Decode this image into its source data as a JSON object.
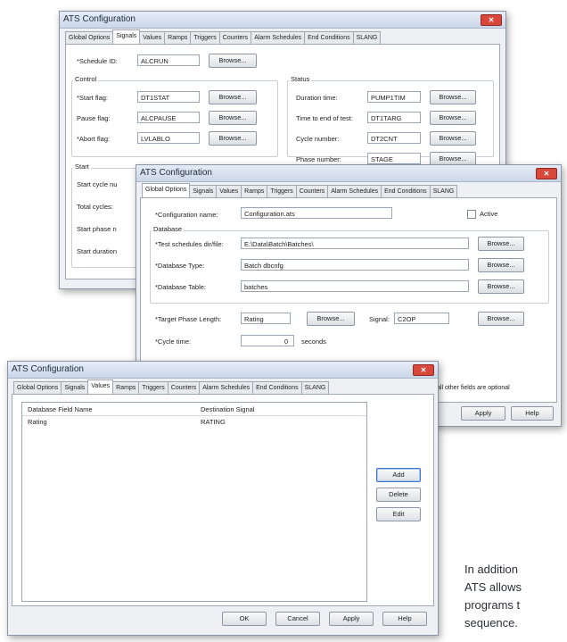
{
  "window1": {
    "title": "ATS Configuration",
    "tabs": [
      "Global Options",
      "Signals",
      "Values",
      "Ramps",
      "Triggers",
      "Counters",
      "Alarm Schedules",
      "End Conditions",
      "SLANG"
    ],
    "active_tab": "Signals",
    "schedule_id_label": "*Schedule ID:",
    "schedule_id_value": "ALCRUN",
    "browse": "Browse...",
    "control_label": "Control",
    "start_flag_label": "*Start flag:",
    "start_flag_value": "DT1STAT",
    "pause_flag_label": "Pause flag:",
    "pause_flag_value": "ALCPAUSE",
    "abort_flag_label": "*Abort flag:",
    "abort_flag_value": "LVLABLO",
    "status_label": "Status",
    "duration_label": "Duration time:",
    "duration_value": "PUMP1TIM",
    "time_to_end_label": "Time to end of test:",
    "time_to_end_value": "DT1TARG",
    "cycle_number_label": "Cycle number:",
    "cycle_number_value": "DT2CNT",
    "phase_number_label": "Phase number:",
    "phase_number_value": "STAGE",
    "start_group_label": "Start",
    "start_cycle_label": "Start cycle nu",
    "total_cycles_label": "Total cycles:",
    "start_phase_label": "Start phase n",
    "start_duration_label": "Start duration"
  },
  "window2": {
    "title": "ATS Configuration",
    "tabs": [
      "Global Options",
      "Signals",
      "Values",
      "Ramps",
      "Triggers",
      "Counters",
      "Alarm Schedules",
      "End Conditions",
      "SLANG"
    ],
    "active_tab": "Global Options",
    "config_name_label": "*Configuration name:",
    "config_name_value": "Configuration.ats",
    "active_label": "Active",
    "database_label": "Database",
    "test_dir_label": "*Test schedules dir/file:",
    "test_dir_value": "E:\\Data\\Batch\\Batches\\",
    "db_type_label": "*Database Type:",
    "db_type_value": "Batch dbcnfg",
    "db_table_label": "*Database Table:",
    "db_table_value": "batches",
    "browse": "Browse...",
    "target_phase_label": "*Target Phase Length:",
    "target_phase_value": "Rating",
    "signal_label": "Signal:",
    "signal_value": "C2OP",
    "cycle_time_label": "*Cycle time:",
    "cycle_time_value": "0",
    "seconds_label": "seconds",
    "note": "all other fields are optional",
    "apply": "Apply",
    "help": "Help"
  },
  "window3": {
    "title": "ATS Configuration",
    "tabs": [
      "Global Options",
      "Signals",
      "Values",
      "Ramps",
      "Triggers",
      "Counters",
      "Alarm Schedules",
      "End Conditions",
      "SLANG"
    ],
    "active_tab": "Values",
    "col_field": "Database Field Name",
    "col_signal": "Destination Signal",
    "row_field": "Rating",
    "row_signal": "RATING",
    "add": "Add",
    "delete": "Delete",
    "edit": "Edit",
    "ok": "OK",
    "cancel": "Cancel",
    "apply": "Apply",
    "help": "Help"
  },
  "side_text": {
    "line1": "In addition",
    "line2": "ATS allows",
    "line3": "programs t",
    "line4": "sequence."
  }
}
